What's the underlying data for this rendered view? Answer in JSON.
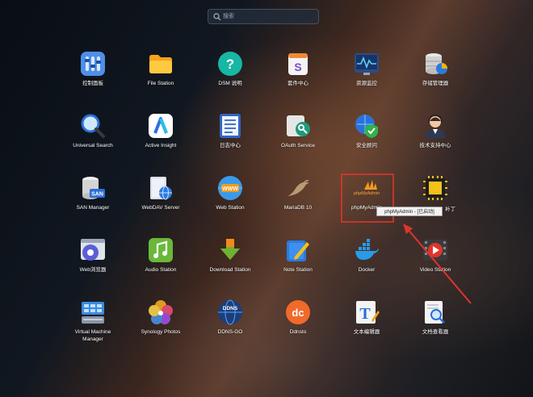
{
  "search": {
    "placeholder": "搜索"
  },
  "apps": [
    {
      "label": "控制面板",
      "icon": "control-panel-icon"
    },
    {
      "label": "File Station",
      "icon": "folder-icon"
    },
    {
      "label": "DSM 说明",
      "icon": "help-icon"
    },
    {
      "label": "套件中心",
      "icon": "package-center-icon"
    },
    {
      "label": "资源监控",
      "icon": "resource-monitor-icon"
    },
    {
      "label": "存储管理器",
      "icon": "storage-manager-icon"
    },
    {
      "label": "Universal Search",
      "icon": "magnifier-icon"
    },
    {
      "label": "Active Insight",
      "icon": "active-insight-icon"
    },
    {
      "label": "日志中心",
      "icon": "log-center-icon"
    },
    {
      "label": "OAuth Service",
      "icon": "oauth-icon"
    },
    {
      "label": "安全顾问",
      "icon": "security-shield-icon"
    },
    {
      "label": "技术支持中心",
      "icon": "support-agent-icon"
    },
    {
      "label": "SAN Manager",
      "icon": "san-icon"
    },
    {
      "label": "WebDAV Server",
      "icon": "webdav-icon"
    },
    {
      "label": "Web Station",
      "icon": "web-station-icon"
    },
    {
      "label": "MariaDB 10",
      "icon": "mariadb-seal-icon"
    },
    {
      "label": "phpMyAdmin",
      "icon": "phpmyadmin-icon"
    },
    {
      "label": "补丁",
      "icon": "chip-icon"
    },
    {
      "label": "Web浏览器",
      "icon": "web-browser-icon"
    },
    {
      "label": "Audio Station",
      "icon": "music-note-icon"
    },
    {
      "label": "Download Station",
      "icon": "download-arrow-icon"
    },
    {
      "label": "Note Station",
      "icon": "note-pen-icon"
    },
    {
      "label": "Docker",
      "icon": "docker-whale-icon"
    },
    {
      "label": "Video Station",
      "icon": "video-play-icon"
    },
    {
      "label": "Virtual Machine Manager",
      "icon": "virtual-machine-icon"
    },
    {
      "label": "Synology Photos",
      "icon": "photos-flower-icon"
    },
    {
      "label": "DDNS-GO",
      "icon": "ddns-globe-icon"
    },
    {
      "label": "Ddnsto",
      "icon": "ddnsto-icon"
    },
    {
      "label": "文本编辑器",
      "icon": "text-editor-icon"
    },
    {
      "label": "文档查看器",
      "icon": "document-viewer-icon"
    }
  ],
  "tooltip": {
    "text": "phpMyAdmin - [已启动]"
  },
  "colors": {
    "highlight": "#e0342c",
    "arrow": "#e0342c"
  }
}
